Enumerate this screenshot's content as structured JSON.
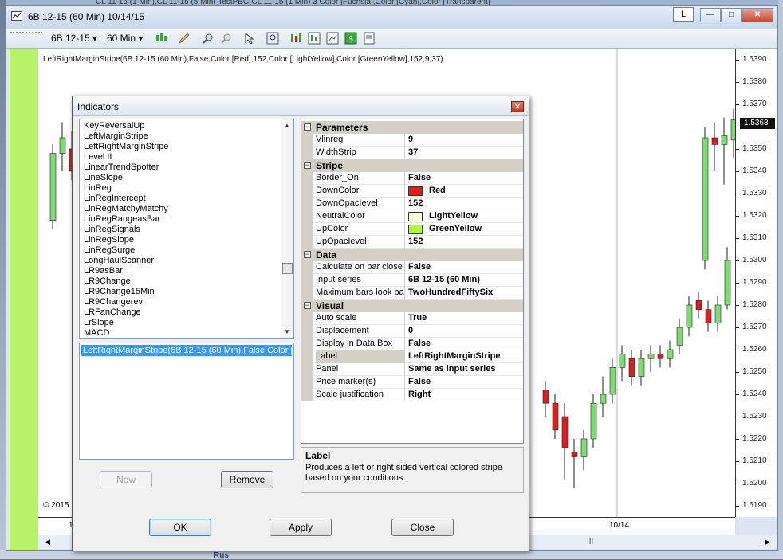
{
  "background": {
    "title_text": "CL 11-15 (1 Min),CL 11-15 (5 Min)  TestPBC(CL 11-15 (1 Min) 3 Color [Fuchsia],Color [Cyan],Color [Transparent]",
    "bottom_text": "Rus"
  },
  "window": {
    "title": "6B 12-15 (60 Min)  10/14/15",
    "l_button": "L",
    "min_glyph": "—",
    "max_glyph": "□",
    "close_glyph": "✕"
  },
  "toolbar": {
    "instrument": "6B 12-15",
    "interval": "60 Min",
    "dropdown_glyph": "▾"
  },
  "chart": {
    "caption": "LeftRightMarginStripe(6B 12-15 (60 Min),False,Color [Red],152,Color [LightYellow],Color [GreenYellow],152,9,37)",
    "copyright": "© 2015",
    "last_price": "1.5363",
    "time_labels": [
      "1",
      "10/14"
    ],
    "scroll_left": "◀",
    "scroll_right": "▶",
    "scroll_grip": "III",
    "up_color": "#7ddc6f",
    "down_color": "#e31a1a",
    "stripe_color": "#b7f26a"
  },
  "chart_data": {
    "type": "line",
    "title": "LeftRightMarginStripe(6B 12-15 (60 Min),False,Color [Red],152,Color [LightYellow],Color [GreenYellow],152,9,37)",
    "y_ticks": [
      "1.5390",
      "1.5380",
      "1.5370",
      "1.5360",
      "1.5350",
      "1.5340",
      "1.5330",
      "1.5320",
      "1.5310",
      "1.5300",
      "1.5290",
      "1.5280",
      "1.5270",
      "1.5260",
      "1.5250",
      "1.5240",
      "1.5230",
      "1.5220",
      "1.5210",
      "1.5200",
      "1.5190"
    ],
    "ylim": [
      1.5185,
      1.5395
    ],
    "x_tick_labels": [
      "10/14"
    ],
    "last_price": 1.5363
  },
  "dialog": {
    "title": "Indicators",
    "close_glyph": "✕",
    "indicator_list": [
      "KeyReversalUp",
      "LeftMarginStripe",
      "LeftRightMarginStripe",
      "Level II",
      "LinearTrendSpotter",
      "LineSlope",
      "LinReg",
      "LinRegIntercept",
      "LinRegMatchyMatchy",
      "LinRegRangeasBar",
      "LinRegSignals",
      "LinRegSlope",
      "LinRegSurge",
      "LongHaulScanner",
      "LR9asBar",
      "LR9Change",
      "LR9Change15Min",
      "LR9Changerev",
      "LRFanChange",
      "LrSlope",
      "MACD"
    ],
    "applied": "LeftRightMarginStripe(6B 12-15 (60 Min),False,Color [Re",
    "buttons": {
      "new": "New",
      "remove": "Remove",
      "ok": "OK",
      "apply": "Apply",
      "close": "Close"
    },
    "properties": {
      "categories": {
        "parameters": "Parameters",
        "stripe": "Stripe",
        "data": "Data",
        "visual": "Visual"
      },
      "toggle_glyph": "−",
      "parameters": [
        {
          "name": "Vlinreg",
          "value": "9"
        },
        {
          "name": "WidthStrip",
          "value": "37"
        }
      ],
      "stripe": [
        {
          "name": "Border_On",
          "value": "False"
        },
        {
          "name": "DownColor",
          "value": "Red",
          "swatch": "#e31a1a"
        },
        {
          "name": "DownOpacIevel",
          "value": "152"
        },
        {
          "name": "NeutralColor",
          "value": "LightYellow",
          "swatch": "#ffffe0"
        },
        {
          "name": "UpColor",
          "value": "GreenYellow",
          "swatch": "#adff2f"
        },
        {
          "name": "UpOpacIevel",
          "value": "152"
        }
      ],
      "data": [
        {
          "name": "Calculate on bar close",
          "value": "False"
        },
        {
          "name": "Input series",
          "value": "6B 12-15 (60 Min)"
        },
        {
          "name": "Maximum bars look ba",
          "value": "TwoHundredFiftySix"
        }
      ],
      "visual": [
        {
          "name": "Auto scale",
          "value": "True"
        },
        {
          "name": "Displacement",
          "value": "0"
        },
        {
          "name": "Display in Data Box",
          "value": "False"
        },
        {
          "name": "Label",
          "value": "LeftRightMarginStripe"
        },
        {
          "name": "Panel",
          "value": "Same as input series"
        },
        {
          "name": "Price marker(s)",
          "value": "False"
        },
        {
          "name": "Scale justification",
          "value": "Right"
        }
      ]
    },
    "help": {
      "title": "Label",
      "text": "Produces a left or right sided vertical colored stripe based on your conditions."
    }
  }
}
